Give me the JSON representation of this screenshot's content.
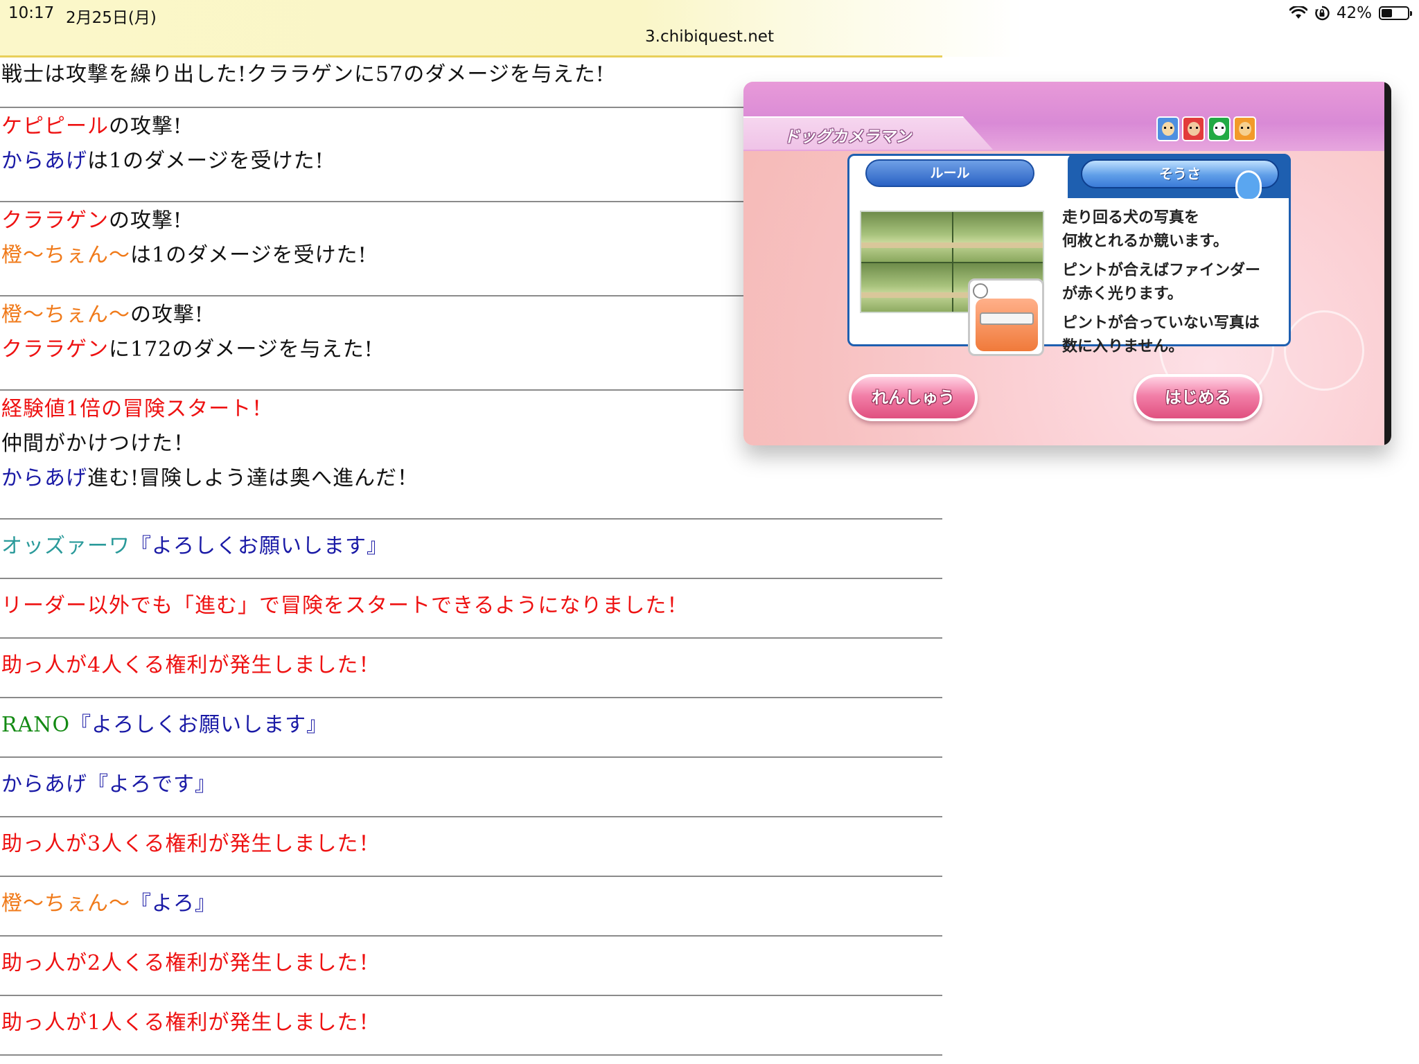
{
  "status_bar": {
    "time": "10:17",
    "date": "2月25日(月)",
    "battery_percent": "42%",
    "battery_level": 0.42,
    "wifi_icon": "wifi-icon",
    "lock_icon": "orientation-lock-icon"
  },
  "browser": {
    "url": "3.chibiquest.net"
  },
  "log": [
    {
      "lines": [
        [
          {
            "text": "戦士は攻撃を繰り出した!クララゲンに57のダメージを与えた!",
            "color": "black"
          }
        ]
      ]
    },
    {
      "lines": [
        [
          {
            "text": "ケピピール",
            "color": "red"
          },
          {
            "text": "の攻撃!",
            "color": "black"
          }
        ],
        [
          {
            "text": "からあげ",
            "color": "blue"
          },
          {
            "text": "は1のダメージを受けた!",
            "color": "black"
          }
        ]
      ]
    },
    {
      "lines": [
        [
          {
            "text": "クララゲン",
            "color": "red"
          },
          {
            "text": "の攻撃!",
            "color": "black"
          }
        ],
        [
          {
            "text": "橙〜ちぇん〜",
            "color": "orange"
          },
          {
            "text": "は1のダメージを受けた!",
            "color": "black"
          }
        ]
      ]
    },
    {
      "lines": [
        [
          {
            "text": "橙〜ちぇん〜",
            "color": "orange"
          },
          {
            "text": "の攻撃!",
            "color": "black"
          }
        ],
        [
          {
            "text": "クララゲン",
            "color": "red"
          },
          {
            "text": "に172のダメージを与えた!",
            "color": "black"
          }
        ]
      ]
    },
    {
      "lines": [
        [
          {
            "text": "経験値1倍の冒険スタート！",
            "color": "red"
          }
        ],
        [
          {
            "text": "仲間がかけつけた！",
            "color": "black"
          }
        ],
        [
          {
            "text": "からあげ",
            "color": "blue"
          },
          {
            "text": "進む!冒険しよう達は奥へ進んだ！",
            "color": "black"
          }
        ]
      ]
    },
    {
      "lines": [
        [
          {
            "text": "オッズァーワ",
            "color": "teal"
          },
          {
            "text": "『よろしくお願いします』",
            "color": "blue"
          }
        ]
      ]
    },
    {
      "lines": [
        [
          {
            "text": "リーダー以外でも「進む」で冒険をスタートできるようになりました！",
            "color": "red"
          }
        ]
      ]
    },
    {
      "lines": [
        [
          {
            "text": "助っ人が4人くる権利が発生しました！",
            "color": "red"
          }
        ]
      ]
    },
    {
      "lines": [
        [
          {
            "text": "RANO",
            "color": "green"
          },
          {
            "text": "『よろしくお願いします』",
            "color": "blue"
          }
        ]
      ]
    },
    {
      "lines": [
        [
          {
            "text": "からあげ",
            "color": "blue"
          },
          {
            "text": "『よろです』",
            "color": "blue"
          }
        ]
      ]
    },
    {
      "lines": [
        [
          {
            "text": "助っ人が3人くる権利が発生しました！",
            "color": "red"
          }
        ]
      ]
    },
    {
      "lines": [
        [
          {
            "text": "橙〜ちぇん〜",
            "color": "orange"
          },
          {
            "text": "『よろ』",
            "color": "blue"
          }
        ]
      ]
    },
    {
      "lines": [
        [
          {
            "text": "助っ人が2人くる権利が発生しました！",
            "color": "red"
          }
        ]
      ]
    },
    {
      "lines": [
        [
          {
            "text": "助っ人が1人くる権利が発生しました！",
            "color": "red"
          }
        ]
      ]
    }
  ],
  "game_overlay": {
    "title": "ドッグカメラマン",
    "tabs": {
      "rule": "ルール",
      "controls": "そうさ"
    },
    "description_lines": [
      "走り回る犬の写真を",
      "何枚とれるか競います。",
      "ピントが合えばファインダー",
      "が赤く光ります。",
      "ピントが合っていない写真は",
      "数に入りません。"
    ],
    "buttons": {
      "practice": "れんしゅう",
      "start": "はじめる"
    },
    "player_icons": [
      "mii-icon",
      "mii-icon",
      "mii-icon",
      "mii-icon"
    ]
  },
  "colors": {
    "red": "#ee1111",
    "blue": "#1a1aa6",
    "orange": "#f07a1a",
    "teal": "#2a9a9a",
    "green": "#138a13",
    "black": "#111111"
  }
}
